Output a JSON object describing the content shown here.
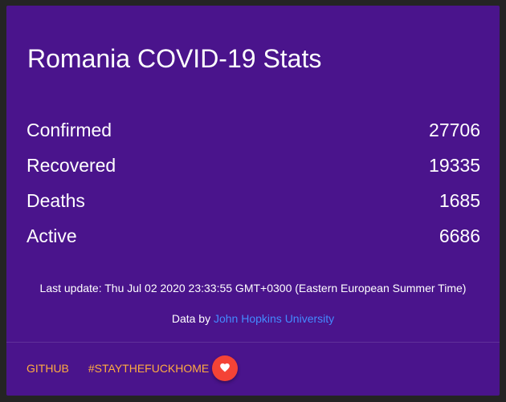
{
  "card": {
    "title": "Romania COVID-19 Stats",
    "stats": [
      {
        "label": "Confirmed",
        "value": "27706"
      },
      {
        "label": "Recovered",
        "value": "19335"
      },
      {
        "label": "Deaths",
        "value": "1685"
      },
      {
        "label": "Active",
        "value": "6686"
      }
    ],
    "last_update": "Last update: Thu Jul 02 2020 23:33:55 GMT+0300 (Eastern European Summer Time)",
    "source": {
      "prefix": "Data by",
      "link_text": "John Hopkins University"
    },
    "actions": {
      "github_label": "GITHUB",
      "stayhome_label": "#STAYTHEFUCKHOME",
      "heart_icon": "heart-icon"
    }
  },
  "colors": {
    "card_background": "#4a148c",
    "page_background": "#242424",
    "link": "#448aff",
    "action_text": "#ffab40",
    "heart_button": "#f44336"
  }
}
